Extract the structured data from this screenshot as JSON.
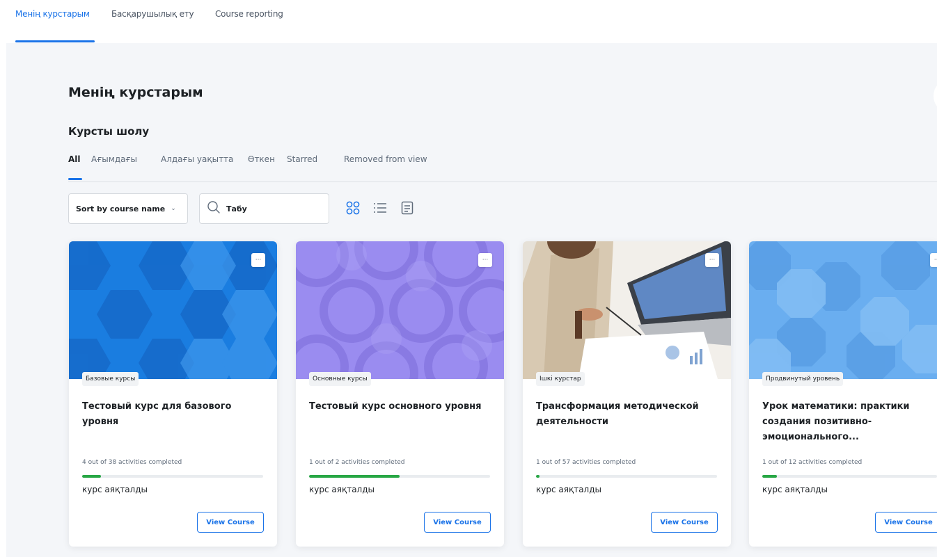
{
  "top_tabs": [
    {
      "label": "Менің курстарым",
      "active": true
    },
    {
      "label": "Басқарушылық ету",
      "active": false
    },
    {
      "label": "Course reporting",
      "active": false
    }
  ],
  "page_title": "Менің курстарым",
  "section_title": "Курсты шолу",
  "filter_tabs": [
    {
      "label": "All",
      "active": true
    },
    {
      "label": "Ағымдағы",
      "active": false
    },
    {
      "label": "Алдағы уақытта",
      "active": false
    },
    {
      "label": "Өткен",
      "active": false
    },
    {
      "label": "Starred",
      "active": false
    },
    {
      "label": "Removed from view",
      "active": false
    }
  ],
  "sort": {
    "label": "Sort by course name"
  },
  "search": {
    "placeholder": "Табу",
    "value": ""
  },
  "view_modes": [
    {
      "icon": "grid-view-icon",
      "active": true
    },
    {
      "icon": "list-view-icon",
      "active": false
    },
    {
      "icon": "summary-view-icon",
      "active": false
    }
  ],
  "colors": {
    "accent": "#1a73e8",
    "progress": "#28a745",
    "background": "#f4f6f9"
  },
  "courses": [
    {
      "category": "Базовые курсы",
      "title": "Тестовый курс для базового уровня",
      "progress_text": "4 out of 38 activities completed",
      "progress": 0.105,
      "status": "курс аяқталды",
      "button": "View Course",
      "image": "blue-hexagon-pattern"
    },
    {
      "category": "Основные курсы",
      "title": "Тестовый курс основного уровня",
      "progress_text": "1 out of 2 activities completed",
      "progress": 0.5,
      "status": "курс аяқталды",
      "button": "View Course",
      "image": "purple-circle-pattern"
    },
    {
      "category": "Ішкі курстар",
      "title": "Трансформация методической деятельности",
      "progress_text": "1 out of 57 activities completed",
      "progress": 0.018,
      "status": "курс аяқталды",
      "button": "View Course",
      "image": "laptop-photo"
    },
    {
      "category": "Продвинутый уровень",
      "title": "Урок математики: практики создания позитивно-эмоционального...",
      "progress_text": "1 out of 12 activities completed",
      "progress": 0.083,
      "status": "курс аяқталды",
      "button": "View Course",
      "image": "light-blue-octagon-pattern"
    }
  ]
}
